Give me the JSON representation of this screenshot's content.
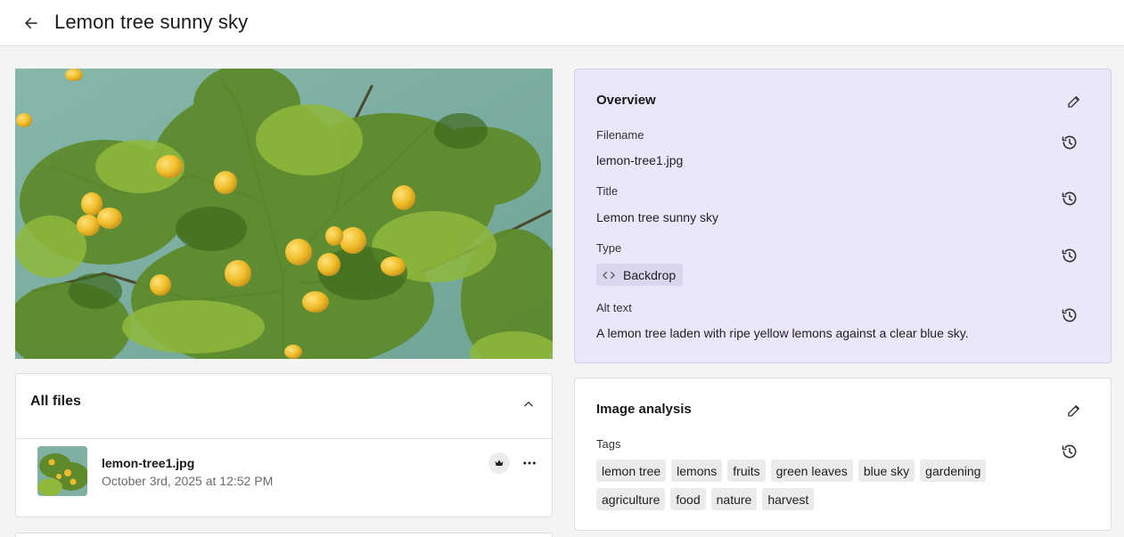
{
  "header": {
    "title": "Lemon tree sunny sky",
    "back_icon": "arrow-left-icon"
  },
  "preview": {
    "alt": "A lemon tree laden with ripe yellow lemons against a clear blue sky."
  },
  "files": {
    "title": "All files",
    "collapse_icon": "chevron-up-icon",
    "items": [
      {
        "name": "lemon-tree1.jpg",
        "date": "October 3rd, 2025 at 12:52 PM",
        "primary_icon": "crown-icon",
        "menu_icon": "more-horizontal-icon"
      }
    ]
  },
  "overview": {
    "title": "Overview",
    "edit_icon": "pencil-icon",
    "history_icon": "history-icon",
    "filename_label": "Filename",
    "filename_value": "lemon-tree1.jpg",
    "title_label": "Title",
    "title_value": "Lemon tree sunny sky",
    "type_label": "Type",
    "type_value": "Backdrop",
    "type_icon": "code-icon",
    "alt_label": "Alt text",
    "alt_value": "A lemon tree laden with ripe yellow lemons against a clear blue sky."
  },
  "analysis": {
    "title": "Image analysis",
    "tags_label": "Tags",
    "tags": [
      "lemon tree",
      "lemons",
      "fruits",
      "green leaves",
      "blue sky",
      "gardening",
      "agriculture",
      "food",
      "nature",
      "harvest"
    ]
  },
  "colors": {
    "overview_bg": "#ece6fb",
    "type_chip_bg": "#dcd5ee",
    "page_bg": "#f4f4f4",
    "sky": "#7fb0a4",
    "lemon": "#f1c232"
  }
}
